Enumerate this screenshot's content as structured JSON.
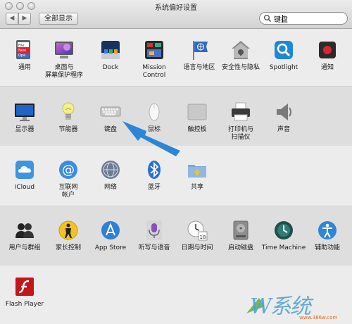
{
  "window": {
    "title": "系统偏好设置"
  },
  "toolbar": {
    "back_label": "◀",
    "forward_label": "▶",
    "show_all_label": "全部显示"
  },
  "search": {
    "value": "键盘"
  },
  "rows": [
    {
      "items": [
        {
          "label": "通用",
          "icon": "general-icon"
        },
        {
          "label": "桌面与\n屏幕保护程序",
          "icon": "desktop-screensaver-icon"
        },
        {
          "label": "Dock",
          "icon": "dock-icon"
        },
        {
          "label": "Mission\nControl",
          "icon": "mission-control-icon"
        },
        {
          "label": "语言与地区",
          "icon": "language-region-icon"
        },
        {
          "label": "安全性与隐私",
          "icon": "security-privacy-icon"
        },
        {
          "label": "Spotlight",
          "icon": "spotlight-icon"
        },
        {
          "label": "通知",
          "icon": "notifications-icon"
        }
      ]
    },
    {
      "items": [
        {
          "label": "显示器",
          "icon": "displays-icon"
        },
        {
          "label": "节能器",
          "icon": "energy-saver-icon"
        },
        {
          "label": "键盘",
          "icon": "keyboard-icon"
        },
        {
          "label": "鼠标",
          "icon": "mouse-icon"
        },
        {
          "label": "触控板",
          "icon": "trackpad-icon"
        },
        {
          "label": "打印机与\n扫描仪",
          "icon": "printers-scanners-icon"
        },
        {
          "label": "声音",
          "icon": "sound-icon"
        }
      ]
    },
    {
      "items": [
        {
          "label": "iCloud",
          "icon": "icloud-icon"
        },
        {
          "label": "互联网\n帐户",
          "icon": "internet-accounts-icon"
        },
        {
          "label": "网络",
          "icon": "network-icon"
        },
        {
          "label": "蓝牙",
          "icon": "bluetooth-icon"
        },
        {
          "label": "共享",
          "icon": "sharing-icon"
        }
      ]
    },
    {
      "items": [
        {
          "label": "用户与群组",
          "icon": "users-groups-icon"
        },
        {
          "label": "家长控制",
          "icon": "parental-controls-icon"
        },
        {
          "label": "App Store",
          "icon": "app-store-icon"
        },
        {
          "label": "听写与语音",
          "icon": "dictation-speech-icon"
        },
        {
          "label": "日期与时间",
          "icon": "date-time-icon"
        },
        {
          "label": "启动磁盘",
          "icon": "startup-disk-icon"
        },
        {
          "label": "Time Machine",
          "icon": "time-machine-icon"
        },
        {
          "label": "辅助功能",
          "icon": "accessibility-icon"
        }
      ]
    },
    {
      "items": [
        {
          "label": "Flash Player",
          "icon": "flash-player-icon"
        }
      ]
    }
  ],
  "watermark": {
    "text": "W系统",
    "url": "www.386w.com"
  },
  "colors": {
    "arrow": "#2b86d6",
    "toolbar_border": "#a4a4a4"
  }
}
